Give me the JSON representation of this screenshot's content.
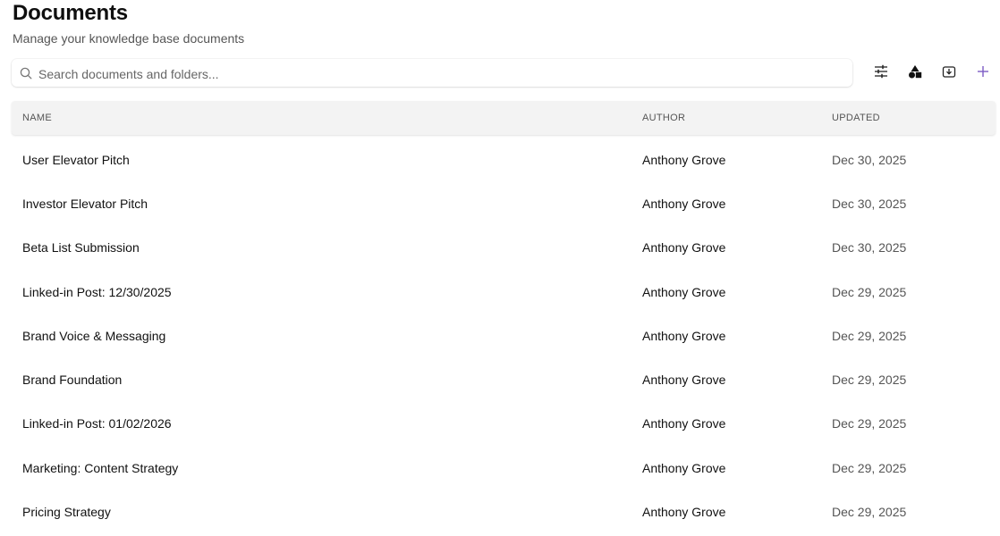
{
  "header": {
    "title": "Documents",
    "subtitle": "Manage your knowledge base documents"
  },
  "search": {
    "placeholder": "Search documents and folders...",
    "value": ""
  },
  "toolbar": {
    "icons": [
      "sliders-icon",
      "shapes-icon",
      "import-icon",
      "plus-icon"
    ],
    "accent": "#7c5cc4"
  },
  "table": {
    "columns": [
      "NAME",
      "AUTHOR",
      "UPDATED"
    ],
    "rows": [
      {
        "name": "User Elevator Pitch",
        "author": "Anthony Grove",
        "updated": "Dec 30, 2025"
      },
      {
        "name": "Investor Elevator Pitch",
        "author": "Anthony Grove",
        "updated": "Dec 30, 2025"
      },
      {
        "name": "Beta List Submission",
        "author": "Anthony Grove",
        "updated": "Dec 30, 2025"
      },
      {
        "name": "Linked-in Post: 12/30/2025",
        "author": "Anthony Grove",
        "updated": "Dec 29, 2025"
      },
      {
        "name": "Brand Voice & Messaging",
        "author": "Anthony Grove",
        "updated": "Dec 29, 2025"
      },
      {
        "name": "Brand Foundation",
        "author": "Anthony Grove",
        "updated": "Dec 29, 2025"
      },
      {
        "name": "Linked-in Post: 01/02/2026",
        "author": "Anthony Grove",
        "updated": "Dec 29, 2025"
      },
      {
        "name": "Marketing: Content Strategy",
        "author": "Anthony Grove",
        "updated": "Dec 29, 2025"
      },
      {
        "name": "Pricing Strategy",
        "author": "Anthony Grove",
        "updated": "Dec 29, 2025"
      }
    ]
  }
}
